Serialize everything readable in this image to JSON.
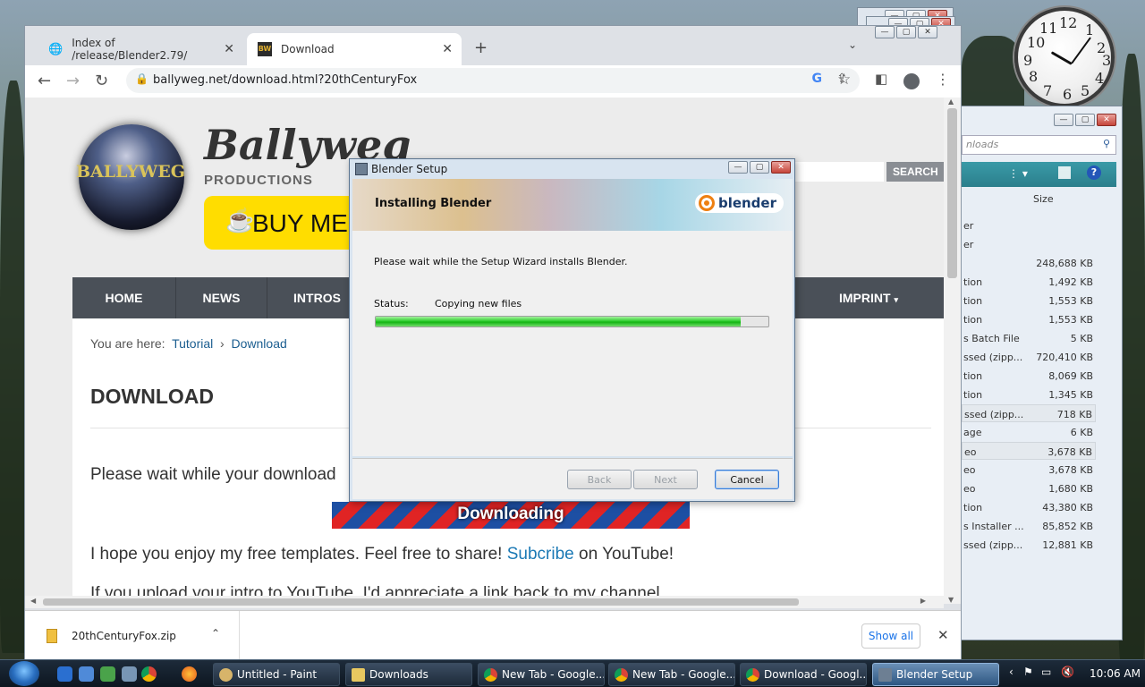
{
  "browser": {
    "tabs": [
      {
        "label": "Index of /release/Blender2.79/",
        "active": false
      },
      {
        "label": "Download",
        "active": true
      }
    ],
    "new_tab_label": "+",
    "url": "ballyweg.net/download.html?20thCenturyFox"
  },
  "site": {
    "logo_text": "BALLYWEG",
    "title": "Ballyweg",
    "subtitle": "PRODUCTIONS",
    "buy_button": "BUY ME",
    "search_button": "SEARCH",
    "nav": [
      "HOME",
      "NEWS",
      "INTROS",
      "IMPRINT"
    ],
    "breadcrumb_prefix": "You are here:",
    "breadcrumb": [
      "Tutorial",
      "Download"
    ],
    "breadcrumb_sep": "›",
    "heading": "DOWNLOAD",
    "wait_text": "Please wait while your download",
    "banner": "Downloading",
    "enjoy_text": "I hope you enjoy my free templates. Feel free to share!",
    "subscribe_link": "Subcribe",
    "youtube_text": "on YouTube!",
    "upload_text": "If you upload your intro to YouTube, I'd appreciate a link back to my channel"
  },
  "download_bar": {
    "file": "20thCenturyFox.zip",
    "show_all": "Show all"
  },
  "setup": {
    "title": "Blender Setup",
    "header": "Installing Blender",
    "logo": "blender",
    "message": "Please wait while the Setup Wizard installs Blender.",
    "status_label": "Status:",
    "status_value": "Copying new files",
    "progress": 0.93,
    "buttons": {
      "back": "Back",
      "next": "Next",
      "cancel": "Cancel"
    }
  },
  "explorer": {
    "search_placeholder": "nloads",
    "size_header": "Size",
    "rows": [
      {
        "type": "er",
        "size": ""
      },
      {
        "type": "er",
        "size": ""
      },
      {
        "type": "",
        "size": "248,688 KB"
      },
      {
        "type": "tion",
        "size": "1,492 KB"
      },
      {
        "type": "tion",
        "size": "1,553 KB"
      },
      {
        "type": "tion",
        "size": "1,553 KB"
      },
      {
        "type": "s Batch File",
        "size": "5 KB"
      },
      {
        "type": "ssed (zipp...",
        "size": "720,410 KB"
      },
      {
        "type": "tion",
        "size": "8,069 KB"
      },
      {
        "type": "tion",
        "size": "1,345 KB"
      },
      {
        "type": "ssed (zipp...",
        "size": "718 KB",
        "selected": true
      },
      {
        "type": "age",
        "size": "6 KB"
      },
      {
        "type": "eo",
        "size": "3,678 KB",
        "selected": true
      },
      {
        "type": "eo",
        "size": "3,678 KB"
      },
      {
        "type": "eo",
        "size": "1,680 KB"
      },
      {
        "type": "tion",
        "size": "43,380 KB"
      },
      {
        "type": "s Installer ...",
        "size": "85,852 KB"
      },
      {
        "type": "ssed (zipp...",
        "size": "12,881 KB"
      }
    ]
  },
  "clock": {
    "numbers": [
      "12",
      "1",
      "2",
      "3",
      "4",
      "5",
      "6",
      "7",
      "8",
      "9",
      "10",
      "11"
    ]
  },
  "taskbar": {
    "items": [
      {
        "label": "Untitled - Paint",
        "active": false
      },
      {
        "label": "Downloads",
        "active": false
      },
      {
        "label": "New Tab - Google...",
        "active": false
      },
      {
        "label": "New Tab - Google...",
        "active": false
      },
      {
        "label": "Download - Googl...",
        "active": false
      },
      {
        "label": "Blender Setup",
        "active": true
      }
    ],
    "time": "10:06 AM"
  }
}
